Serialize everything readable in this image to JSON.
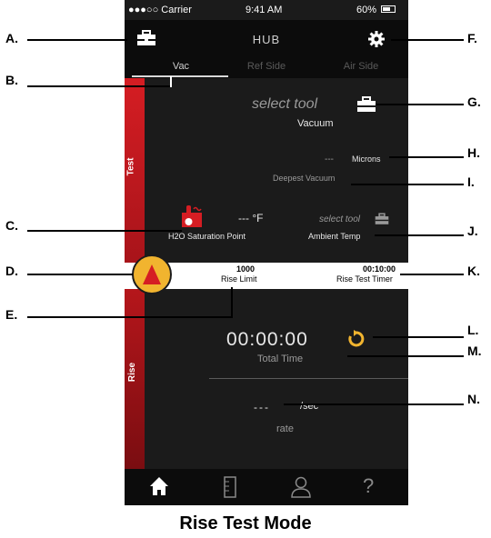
{
  "status_bar": {
    "carrier": "●●●○○ Carrier",
    "time": "9:41 AM",
    "battery": "60%"
  },
  "header": {
    "title": "HUB",
    "left_icon": "toolbox-icon",
    "right_icon": "gear-icon"
  },
  "tabs": [
    {
      "label": "Vac",
      "active": true
    },
    {
      "label": "Ref Side",
      "active": false
    },
    {
      "label": "Air Side",
      "active": false
    }
  ],
  "side_labels": {
    "test": "Test",
    "rise": "Rise"
  },
  "vacuum": {
    "select_tool": "select tool",
    "label": "Vacuum",
    "microns_value": "---",
    "microns_unit": "Microns",
    "deepest_label": "Deepest Vacuum"
  },
  "h2o": {
    "value": "--- °F",
    "label": "H2O Saturation Point"
  },
  "ambient": {
    "select_tool": "select tool",
    "label": "Ambient Temp"
  },
  "rise_limit": {
    "value": "1000",
    "label": "Rise Limit"
  },
  "rise_timer": {
    "value": "00:10:00",
    "label": "Rise Test Timer"
  },
  "total_time": {
    "value": "00:00:00",
    "label": "Total Time"
  },
  "rate": {
    "value": "---",
    "unit": "/sec",
    "label": "rate"
  },
  "tabbar": [
    "home-icon",
    "ruler-icon",
    "user-icon",
    "help-icon"
  ],
  "annotations": [
    "A.",
    "B.",
    "C.",
    "D.",
    "E.",
    "F.",
    "G.",
    "H.",
    "I.",
    "J.",
    "K.",
    "L.",
    "M.",
    "N."
  ],
  "caption": "Rise Test Mode",
  "colors": {
    "accent_red": "#d51d23",
    "warning_orange": "#f1b42f",
    "background": "#1b1b1b"
  }
}
